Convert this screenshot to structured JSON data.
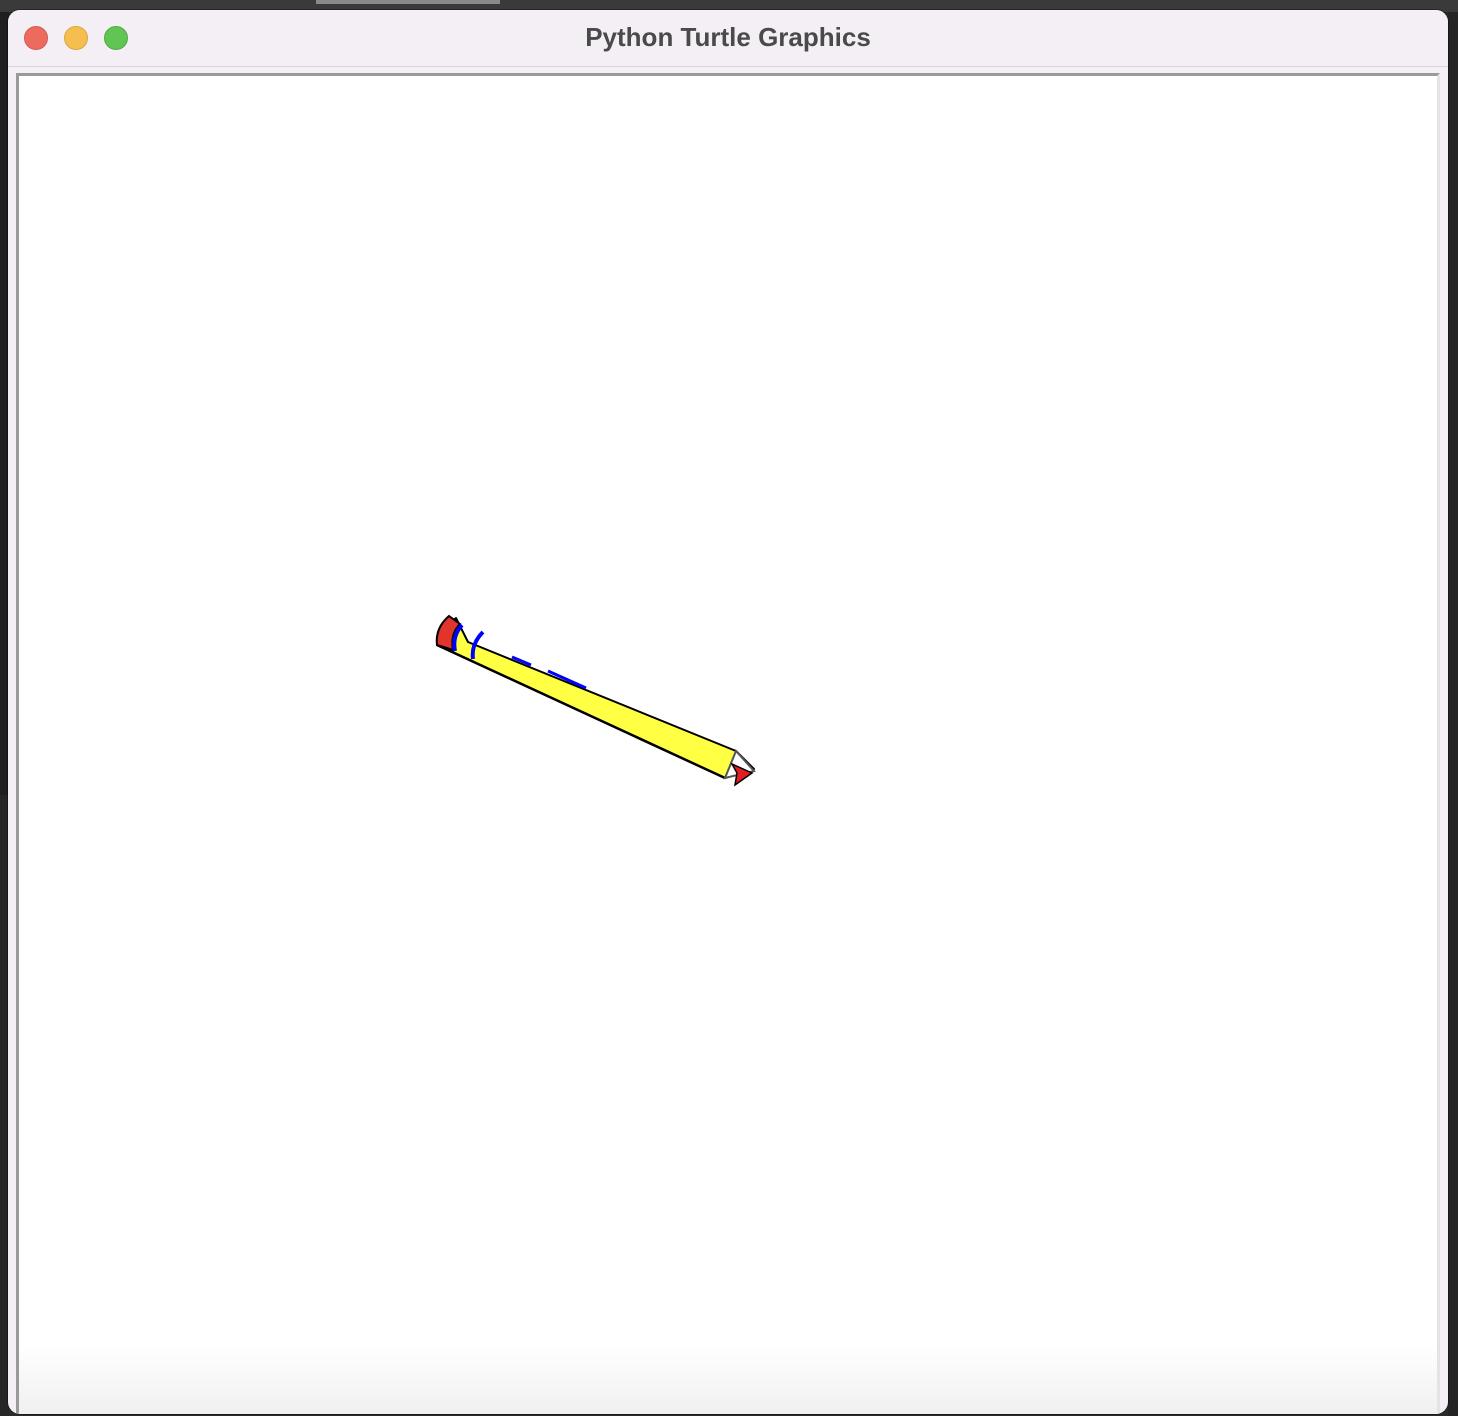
{
  "window": {
    "title": "Python Turtle Graphics"
  },
  "canvas": {
    "background": "#ffffff"
  },
  "pencil": {
    "body_color": "#ffff44",
    "eraser_color": "#e0342c",
    "band_color": "#0000ff",
    "tip_color": "#ffffff",
    "turtle_color": "#e02020"
  },
  "icons": {
    "close": "close-traffic-light",
    "minimize": "minimize-traffic-light",
    "zoom": "zoom-traffic-light",
    "turtle": "turtle-cursor-icon"
  }
}
